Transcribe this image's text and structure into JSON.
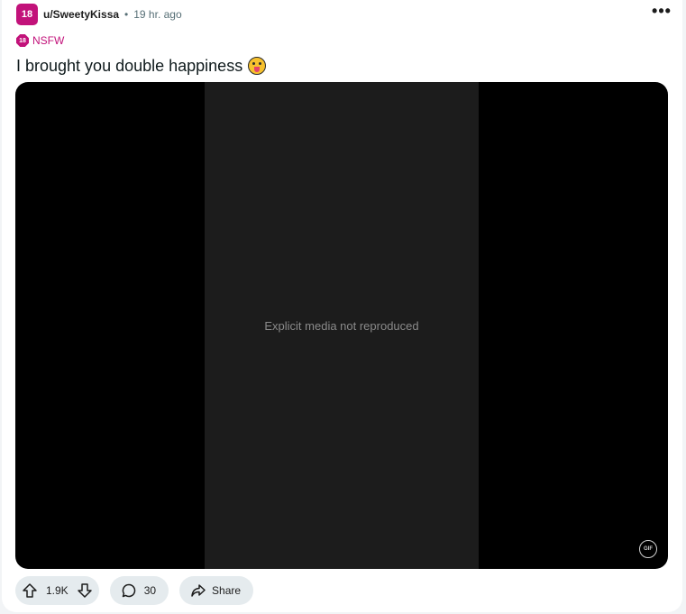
{
  "post": {
    "avatar_label": "18",
    "author": "u/SweetyKissa",
    "separator": "•",
    "time_ago": "19 hr. ago",
    "menu_label": "•••",
    "nsfw": {
      "badge": "18",
      "label": "NSFW"
    },
    "title": "I brought you double happiness",
    "emoji_icon": "tongue-out-winking-face-icon",
    "media": {
      "type": "gif",
      "badge": "GIF",
      "placeholder": "Explicit media not reproduced"
    },
    "actions": {
      "vote_count": "1.9K",
      "comment_count": "30",
      "share_label": "Share"
    }
  },
  "colors": {
    "accent_nsfw": "#c2127a",
    "pill_bg": "#e5ebee",
    "media_bg": "#000000"
  }
}
